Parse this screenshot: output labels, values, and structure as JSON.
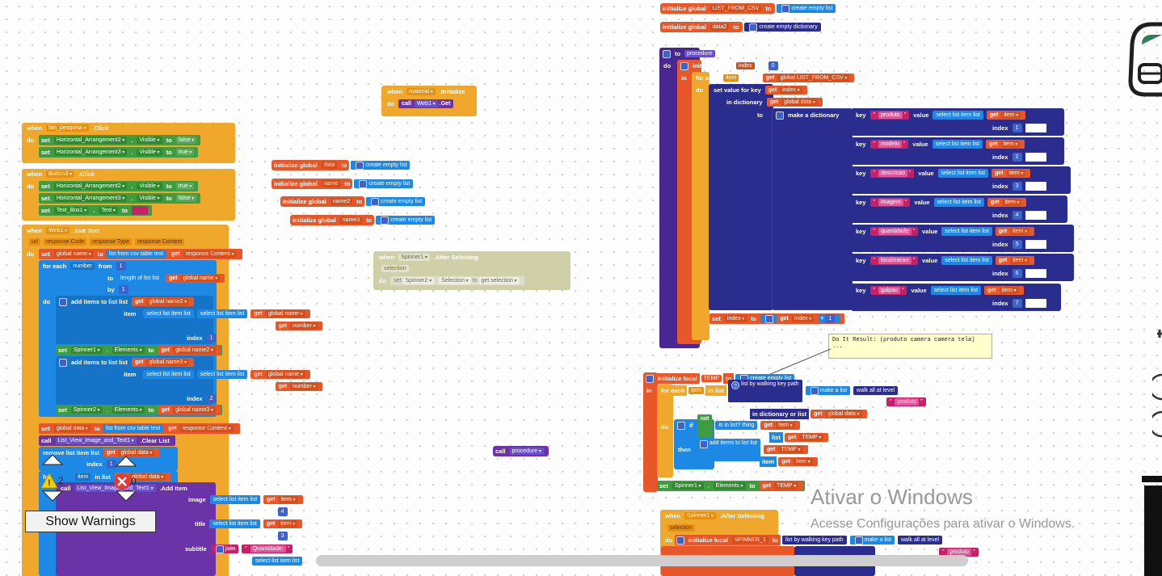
{
  "top": {
    "init1": {
      "kw": "initialize global",
      "name": "LIST_FROM_CSV",
      "to": "to",
      "value": "create empty list"
    },
    "init2": {
      "kw": "initialize global",
      "name": "data2",
      "to": "to",
      "value": "create empty dictionary"
    }
  },
  "material": {
    "when": "when",
    "comp": "material",
    "event": ".Initialize",
    "do": "do",
    "call": "call",
    "web": "Web1",
    "method": ".Get"
  },
  "btn_click": {
    "when": "when",
    "comp": "btn_pesquisa",
    "event": ".Click",
    "do": "do",
    "rows": [
      {
        "set": "set",
        "comp": "Horizontal_Arrangement2",
        "prop": "Visible",
        "to": "to",
        "val": "false"
      },
      {
        "set": "set",
        "comp": "Horizontal_Arrangement3",
        "prop": "Visible",
        "to": "to",
        "val": "true"
      }
    ]
  },
  "btn3_click": {
    "when": "when",
    "comp": "Button3",
    "event": ".Click",
    "do": "do",
    "rows": [
      {
        "set": "set",
        "comp": "Horizontal_Arrangement2",
        "prop": "Visible",
        "to": "to",
        "val": "true"
      },
      {
        "set": "set",
        "comp": "Horizontal_Arrangement3",
        "prop": "Visible",
        "to": "to",
        "val": "false"
      },
      {
        "set": "set",
        "comp": "Text_Box1",
        "prop": "Text",
        "to": "to",
        "val": ""
      }
    ]
  },
  "globals": [
    {
      "kw": "initialize global",
      "name": "data",
      "to": "to",
      "value": "create empty list"
    },
    {
      "kw": "initialize global",
      "name": "name",
      "to": "to",
      "value": "create empty list"
    },
    {
      "kw": "initialize global",
      "name": "name2",
      "to": "to",
      "value": "create empty list"
    },
    {
      "kw": "initialize global",
      "name": "name3",
      "to": "to",
      "value": "create empty list"
    }
  ],
  "gottext": {
    "when": "when",
    "comp": "Web1",
    "event": ".Got Text",
    "params": [
      "url",
      "response Code",
      "response Type",
      "response Content"
    ],
    "do": "do",
    "set": "set",
    "gname": "global name",
    "to": "to",
    "csv": "list from csv table  text",
    "get": "get",
    "rc": "response Content",
    "foreach": "for each",
    "number": "number",
    "from": "from",
    "one": "1",
    "length": "length of list  list",
    "by": "by",
    "additems": "add items to list  list",
    "gname2": "global name2",
    "item": "item",
    "select": "select list item  list",
    "index": "index",
    "spinner1": "Spinner1",
    "elements": "Elements",
    "gname3": "global name3",
    "spinner2": "Spinner2",
    "two": "2",
    "gdata": "global data",
    "clear_call": "call",
    "lvcomp": "List_View_Image_and_Text1",
    "clear": ".Clear List",
    "remove": "remove list item  list",
    "in_list": "in list",
    "additem": ".Add Item",
    "image": "image",
    "title": "title",
    "subtitle": "subtitle",
    "join": "join",
    "quantidade": "Quantidade: ",
    "four": "4",
    "three": "3"
  },
  "spinner_after": {
    "when": "when",
    "comp": "Spinner1",
    "event": ".After Selecting",
    "param": "selection",
    "do": "do",
    "set": "set",
    "spinner": "Spinner2",
    "prop": "Selection",
    "to": "to",
    "get": "get",
    "val": "selection"
  },
  "call_proc": {
    "call": "call",
    "name": "procedure"
  },
  "procedure": {
    "to": "to",
    "name": "procedure",
    "do": "do",
    "init": "initialize local",
    "index": "index",
    "zero": "0",
    "in": "in",
    "foreach": "for each",
    "item": "item",
    "in_list": "in list",
    "get": "get",
    "list": "global LIST_FROM_CSV",
    "setvalue": "set value for key",
    "in_dict": "in dictionary",
    "gdata": "global data",
    "to2": "to",
    "makedict": "make a dictionary",
    "pairs": [
      {
        "key": "produto",
        "idx": "1"
      },
      {
        "key": "modelo",
        "idx": "2"
      },
      {
        "key": "descricao",
        "idx": "3"
      },
      {
        "key": "imagem",
        "idx": "4"
      },
      {
        "key": "quantidade",
        "idx": "5"
      },
      {
        "key": "localizacao",
        "idx": "6"
      },
      {
        "key": "galpao",
        "idx": "7"
      }
    ],
    "keylbl": "key",
    "valuelbl": "value",
    "select": "select list item  list",
    "idxlbl": "index",
    "set": "set",
    "plus": "+",
    "one": "1"
  },
  "comment": {
    "line1": "Do It Result: (produto camera camera tela)",
    "line2": "..."
  },
  "temp": {
    "init": "initialize local",
    "name": "TEMP",
    "to": "to",
    "value": "create empty list",
    "in": "in",
    "foreach": "for each",
    "item": "item",
    "in_list": "in list",
    "walk": "list by walking key path",
    "makelist": "make a list",
    "walkall": "walk all at level",
    "produto": "produto",
    "dictor": "in dictionary or list",
    "get": "get",
    "gdata": "global data",
    "do": "do",
    "if": "if",
    "not": "not",
    "isin": "is in list? thing",
    "list": "list",
    "temp": "TEMP",
    "then": "then",
    "additems": "add items to list  list",
    "itemlbl": "item",
    "set": "set",
    "spinner": "Spinner1",
    "elements": "Elements"
  },
  "spinner_bottom": {
    "when": "when",
    "comp": "Spinner1",
    "event": ".After Selecting",
    "param": "selection",
    "do": "do",
    "init": "initialize local",
    "name": "SPINNER_1",
    "to": "to",
    "walk": "list by walking key path",
    "makelist": "make a list",
    "walkall": "walk all at level",
    "produto": "produto"
  },
  "warnings": {
    "warn_count": "2",
    "err_count": "0",
    "button": "Show Warnings"
  },
  "watermark": {
    "title": "Ativar o Windows",
    "subtitle": "Acesse Configurações para ativar o Windows."
  }
}
